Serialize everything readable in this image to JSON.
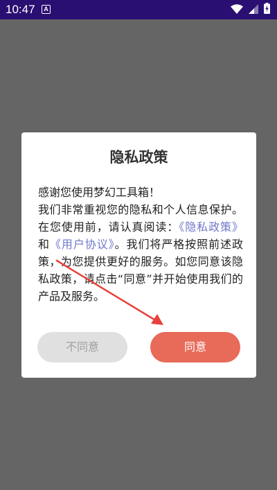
{
  "status_bar": {
    "time": "10:47",
    "notification_letter": "A",
    "icons": [
      "wifi-icon",
      "signal-icon",
      "battery-charging-icon"
    ]
  },
  "dialog": {
    "title": "隐私政策",
    "greeting": "感谢您使用梦幻工具箱！",
    "intro": "我们非常重视您的隐私和个人信息保护。在您使用前，请认真阅读：",
    "privacy_link": "《隐私政策》",
    "conjunction": "和",
    "user_agreement_link": "《用户协议》",
    "outro": "。我们将严格按照前述政策，为您提供更好的服务。如您同意该隐私政策，请点击“同意”并开始使用我们的产品及服务。",
    "disagree_label": "不同意",
    "agree_label": "同意"
  },
  "colors": {
    "status_bar": "#2a0f73",
    "overlay": "#656565",
    "link": "#6e78c8",
    "agree_button": "#e86a58",
    "disagree_button": "#e0e0e0",
    "annotation_arrow": "#e8413b"
  }
}
